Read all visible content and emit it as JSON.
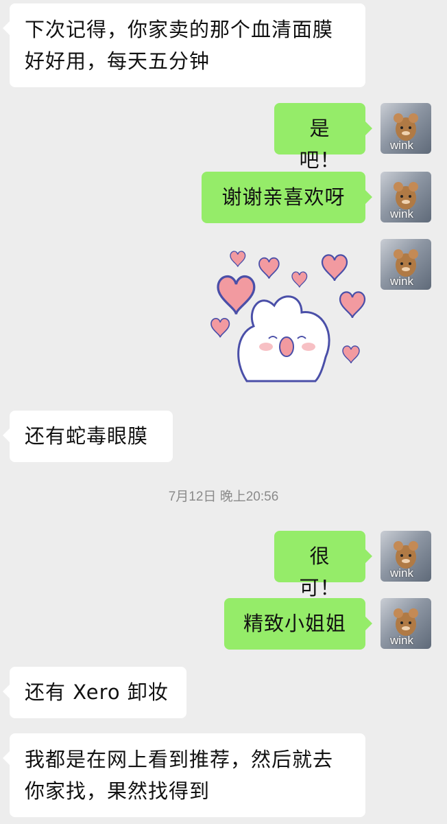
{
  "messages": [
    {
      "lines": [
        "下次记得，你家卖的那个血清面膜",
        "好好用，每天五分钟"
      ]
    },
    {
      "lines": [
        "是吧！"
      ]
    },
    {
      "lines": [
        "谢谢亲喜欢呀"
      ]
    },
    {
      "lines": [
        "还有蛇毒眼膜"
      ]
    },
    {
      "lines": [
        "很可！"
      ]
    },
    {
      "lines": [
        "精致小姐姐"
      ]
    },
    {
      "lines": [
        "还有 Xero 卸妆"
      ]
    },
    {
      "lines": [
        "我都是在网上看到推荐，然后就去",
        "你家找，果然找得到"
      ]
    }
  ],
  "timestamp": "7月12日 晚上20:56",
  "avatar": {
    "label": "wink",
    "icon": "cartoon-mouse-avatar-icon"
  },
  "sticker": {
    "icon": "bunny-hearts-sticker-icon"
  },
  "colors": {
    "background": "#ededed",
    "incoming_bubble": "#ffffff",
    "outgoing_bubble": "#95ec69",
    "heart": "#f29aa0"
  }
}
